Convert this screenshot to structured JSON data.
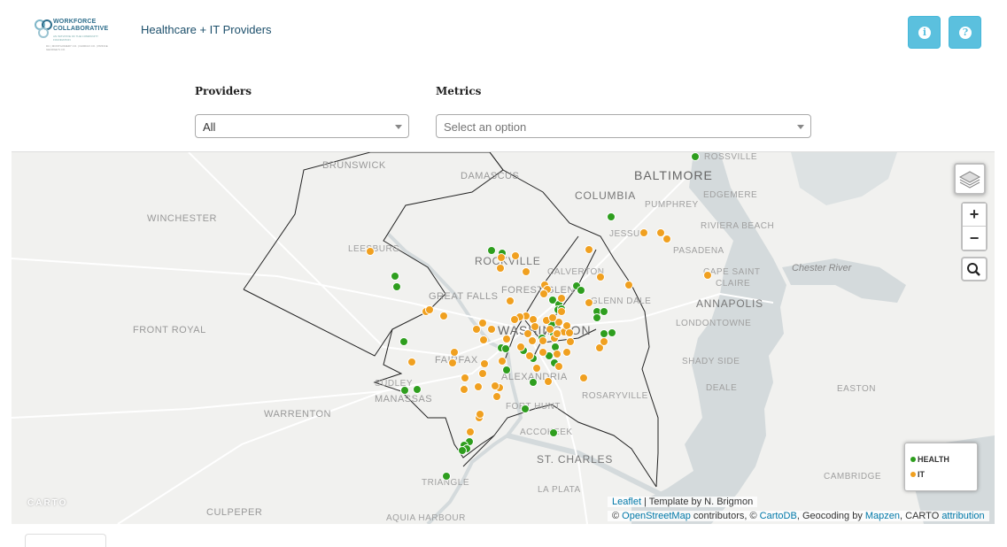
{
  "header": {
    "logo_line1": "WORKFORCE",
    "logo_line2": "COLLABORATIVE",
    "logo_tagline": "AN INITIATIVE OF THE COMMUNITY FOUNDATION",
    "logo_partners": "DC | MONTGOMERY CO. | FAIRFAX CO. | PRINCE GEORGE'S CO.",
    "title": "Healthcare + IT Providers",
    "info_icon": "info-icon",
    "help_icon": "question-icon",
    "button_color": "#5bc0de"
  },
  "filters": {
    "providers_label": "Providers",
    "providers_value": "All",
    "metrics_label": "Metrics",
    "metrics_placeholder": "Select an option"
  },
  "map": {
    "place_labels": [
      "BRUNSWICK",
      "DAMASCUS",
      "COLUMBIA",
      "BALTIMORE",
      "ROSSVILLE",
      "EDGEMERE",
      "PUMPHREY",
      "WINCHESTER",
      "JESSUP",
      "RIVIERA BEACH",
      "PASADENA",
      "LEESBURG",
      "ROCKVILLE",
      "CALVERTON",
      "CAPE SAINT",
      "CLAIRE",
      "FOREST GLEN",
      "GREAT FALLS",
      "GLENN DALE",
      "ANNAPOLIS",
      "FRONT ROYAL",
      "WASHINGTON",
      "LONDONTOWNE",
      "FAIRFAX",
      "SHADY SIDE",
      "SUDLEY",
      "ALEXANDRIA",
      "DEALE",
      "MANASSAS",
      "EASTON",
      "WARRENTON",
      "FORT HUNT",
      "ROSARYVILLE",
      "ACCOKEEK",
      "ST. CHARLES",
      "TRIANGLE",
      "CAMBRIDGE",
      "LA PLATA",
      "CULPEPER",
      "AQUIA HARBOUR",
      "Chester River"
    ],
    "layers_icon": "layers-icon",
    "zoom_in": "+",
    "zoom_out": "−",
    "search_icon": "search-icon",
    "watermark": "CARTO",
    "attribution_line1_link": "Leaflet",
    "attribution_line1_text": " | Template by N. Brigmon",
    "attribution_line2_prefix": "© ",
    "attribution_osm": "OpenStreetMap",
    "attribution_mid1": " contributors, © ",
    "attribution_cartodb": "CartoDB",
    "attribution_mid2": ", Geocoding by ",
    "attribution_mapzen": "Mapzen",
    "attribution_mid3": ", CARTO ",
    "attribution_link": "attribution",
    "health_color": "#2e9e1e",
    "it_color": "#f0a020"
  },
  "legend": {
    "health_label": "HEALTH",
    "it_label": "IT"
  }
}
